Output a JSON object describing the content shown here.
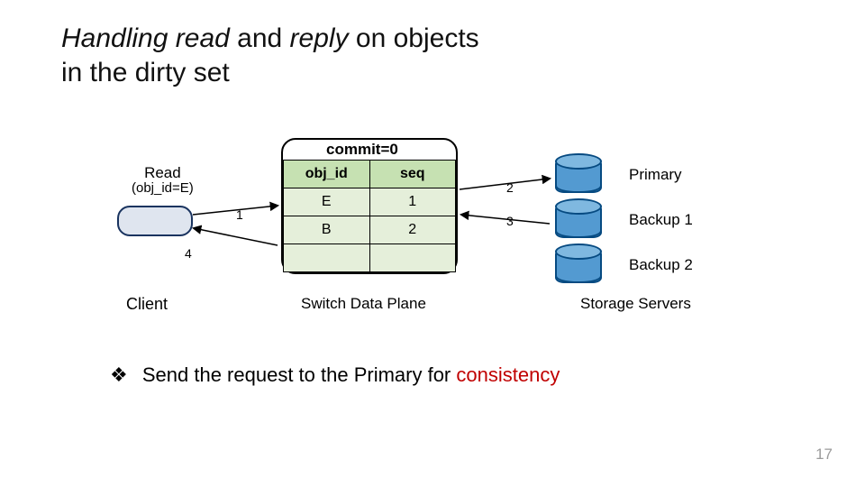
{
  "title": {
    "word1": "Handling",
    "word2": "read",
    "mid": " and ",
    "word3": "reply",
    "rest1": " on objects",
    "line2": "in the dirty set"
  },
  "commit_label": "commit=0",
  "table": {
    "headers": [
      "obj_id",
      "seq"
    ],
    "rows": [
      [
        "E",
        "1"
      ],
      [
        "B",
        "2"
      ]
    ]
  },
  "read": {
    "line1": "Read",
    "line2": "(obj_id=E)"
  },
  "steps": {
    "s1": "1",
    "s2": "2",
    "s3": "3",
    "s4": "4"
  },
  "labels": {
    "client": "Client",
    "dataplane": "Switch Data Plane",
    "storage": "Storage Servers"
  },
  "servers": [
    "Primary",
    "Backup 1",
    "Backup 2"
  ],
  "bullet": {
    "symbol": "❖",
    "pre": "Send the request to the Primary for ",
    "red": "consistency"
  },
  "page_number": "17",
  "chart_data": {
    "type": "table",
    "title": "Dirty set (commit=0)",
    "columns": [
      "obj_id",
      "seq"
    ],
    "rows": [
      {
        "obj_id": "E",
        "seq": 1
      },
      {
        "obj_id": "B",
        "seq": 2
      }
    ]
  }
}
